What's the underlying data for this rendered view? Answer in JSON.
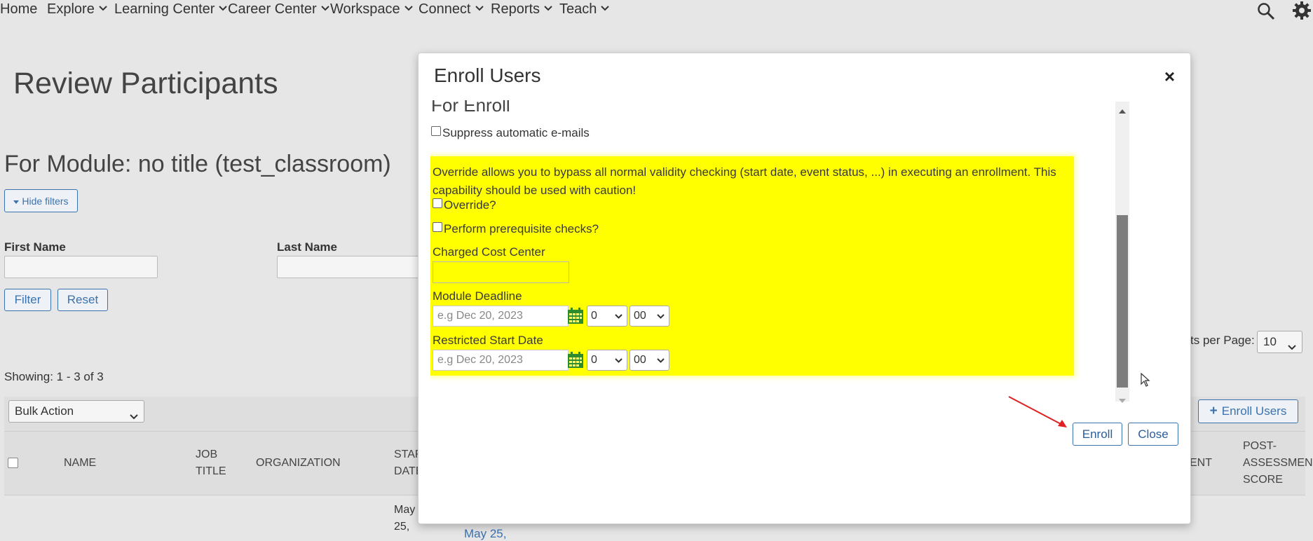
{
  "nav": {
    "items": [
      "Home",
      "Explore",
      "Learning Center",
      "Career Center",
      "Workspace",
      "Connect",
      "Reports",
      "Teach"
    ]
  },
  "page": {
    "title": "Review Participants",
    "module_title": "For Module: no title (test_classroom)",
    "hide_filters": "Hide filters",
    "first_name_label": "First Name",
    "last_name_label": "Last Name",
    "filter_button": "Filter",
    "reset_button": "Reset",
    "showing": "Showing: 1 - 3 of 3",
    "bulk_action": "Bulk Action",
    "results_per_page_label": "ts per Page:",
    "results_per_page_value": "10",
    "enroll_users_button": "Enroll Users",
    "table_headers": {
      "name": "NAME",
      "job_title": "JOB TITLE",
      "organization": "ORGANIZATION",
      "start_date": "STAR DATE",
      "ent": "ENT",
      "post_score": "POST- ASSESSMEN SCORE"
    },
    "row_fragments": {
      "date_a": "May 25,",
      "date_b": "May 25,"
    }
  },
  "modal": {
    "title": "Enroll Users",
    "close_x": "×",
    "section_heading_partial": "For Enroll",
    "suppress_emails": "Suppress automatic e-mails",
    "override_warning": "Override allows you to bypass all normal validity checking (start date, event status, ...) in executing an enrollment. This capability should be used with caution!",
    "override_label": "Override?",
    "prereq_label": "Perform prerequisite checks?",
    "cost_center_label": "Charged Cost Center",
    "module_deadline_label": "Module Deadline",
    "restricted_start_label": "Restricted Start Date",
    "date_placeholder": "e.g Dec 20, 2023",
    "hour_value": "0",
    "minute_value": "00",
    "enroll_button": "Enroll",
    "close_button": "Close"
  },
  "colors": {
    "highlight": "#ffff00",
    "link": "#3a72b0",
    "arrow": "#e02020"
  }
}
